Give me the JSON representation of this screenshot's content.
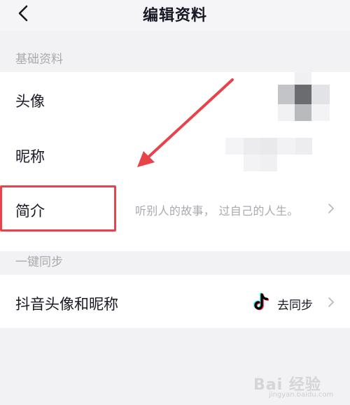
{
  "header": {
    "title": "编辑资料"
  },
  "sections": {
    "basic": "基础资料",
    "sync": "一键同步"
  },
  "rows": {
    "avatar": "头像",
    "nickname": "昵称",
    "intro": {
      "label": "简介",
      "value": "听别人的故事， 过自己的人生。"
    },
    "douyin": {
      "label": "抖音头像和昵称",
      "action": "去同步"
    }
  },
  "watermark": {
    "main": "Bai 经验",
    "sub": "jingyan.baidu.com"
  },
  "colors": {
    "annotation_red": "#e8434a",
    "muted_text": "#a9aab0",
    "page_bg": "#f2f2f4"
  }
}
